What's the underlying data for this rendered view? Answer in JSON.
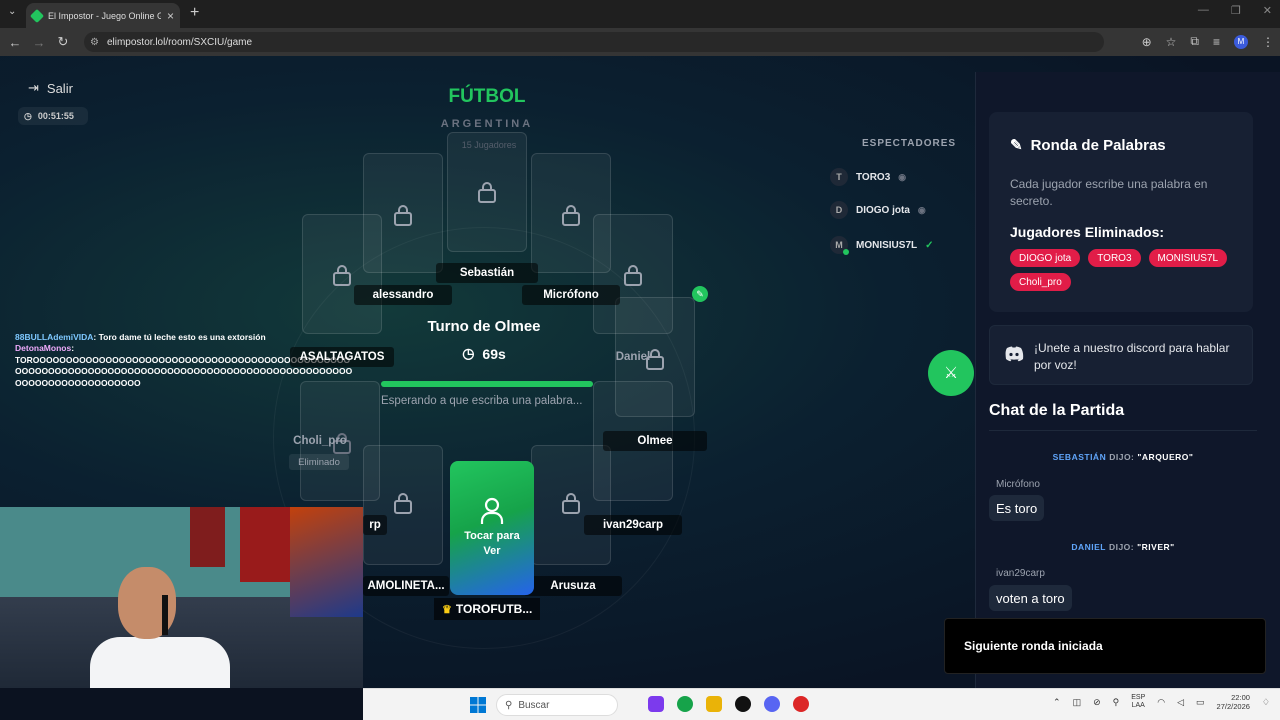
{
  "browser": {
    "tab_title": "El Impostor - Juego Online Gra",
    "url": "elimpostor.lol/room/SXCIU/game",
    "profile_initial": "M"
  },
  "game": {
    "exit_label": "Salir",
    "elapsed": "00:51:55",
    "topic": "FÚTBOL",
    "subtopic": "ARGENTINA",
    "faded_label": "15 Jugadores",
    "turn_text": "Turno de Olmee",
    "countdown": "69s",
    "progress_pct": 100,
    "waiting_text": "Esperando a que escriba una palabra...",
    "reveal_label": "Tocar para Ver",
    "eliminated_tag": "Eliminado",
    "host": "TOROFUTB...",
    "players": {
      "p1": "Sebastián",
      "p2": "alessandro",
      "p3": "Micrófono",
      "p4": "ASALTAGATOS",
      "p5": "Daniel",
      "p6": "Choli_pro",
      "p7": "Olmee",
      "p8": "rp",
      "p9": "ivan29carp",
      "p10": "AMOLINETA...",
      "p11": "Arusuza"
    }
  },
  "spectators": {
    "title": "ESPECTADORES",
    "list": [
      {
        "initial": "T",
        "name": "TORO3"
      },
      {
        "initial": "D",
        "name": "DIOGO jota"
      },
      {
        "initial": "M",
        "name": "MONISIUS7L"
      }
    ]
  },
  "stream_chat": {
    "user1": "88BULLAdemiVIDA",
    "msg1": ": Toro dame tú leche esto es una extorsión",
    "user2": "DetonaMonos",
    "msg2": ":",
    "long_msg": "TOROOOOOOOOOOOOOOOOOOOOOOOOOOOOOOOOOOOOOOOOOOOOOOOOOOOOOOOOOOOOOOOOOOOOOOOOOOOOOOOOOOOOOOOOOOOOOOOOOOOOOOOOOOOOOOOOOOOOOO"
  },
  "panel": {
    "round_title": "Ronda de Palabras",
    "round_desc": "Cada jugador escribe una palabra en secreto.",
    "eliminated_title": "Jugadores Eliminados:",
    "eliminated": [
      "DIOGO jota",
      "TORO3",
      "MONISIUS7L",
      "Choli_pro"
    ],
    "discord_text": "¡Unete a nuestro discord para hablar por voz!",
    "chat_title": "Chat de la Partida",
    "sys1": {
      "who": "SEBASTIÁN",
      "said": "DIJO:",
      "word": "\"ARQUERO\""
    },
    "msg1": {
      "author": "Micrófono",
      "text": "Es toro"
    },
    "sys2": {
      "who": "DANIEL",
      "said": "DIJO:",
      "word": "\"RIVER\""
    },
    "msg2": {
      "author": "ivan29carp",
      "text": "voten a toro"
    },
    "toast": "Siguiente ronda iniciada"
  },
  "taskbar": {
    "search_placeholder": "Buscar",
    "lang_top": "ESP",
    "lang_bottom": "LAA",
    "time": "22:00",
    "date": "27/2/2026"
  },
  "colors": {
    "accent": "#22c55e",
    "eliminated": "#e11d48",
    "panel": "#172033"
  }
}
